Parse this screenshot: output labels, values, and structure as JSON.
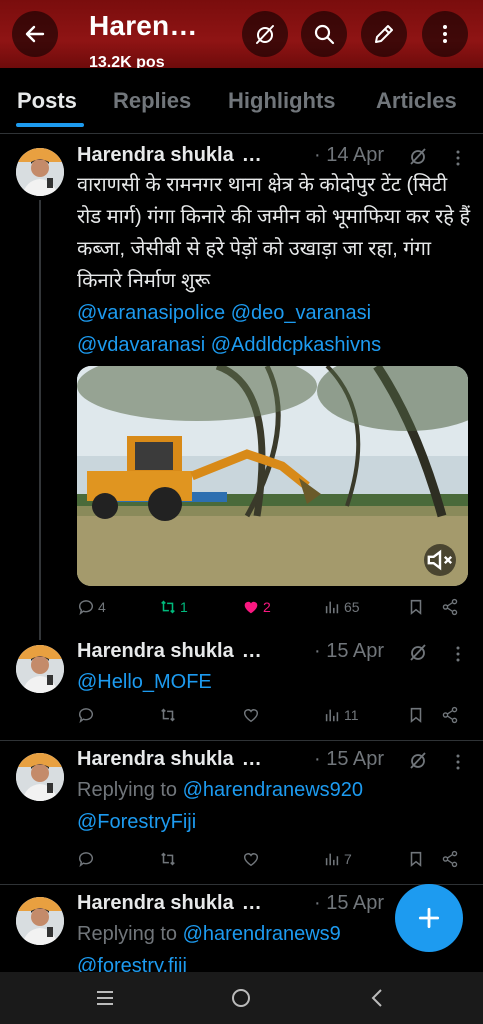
{
  "header": {
    "title": "Haren…",
    "subtitle": "13.2K pos",
    "back_icon": "arrow-left-icon",
    "muted_icon": "bell-off-icon",
    "search_icon": "search-icon",
    "compose_icon": "pen-icon",
    "more_icon": "more-vertical-icon"
  },
  "tabs": [
    {
      "label": "Posts",
      "active": true
    },
    {
      "label": "Replies",
      "active": false
    },
    {
      "label": "Highlights",
      "active": false
    },
    {
      "label": "Articles",
      "active": false
    }
  ],
  "posts": [
    {
      "author": "Harendra shukla",
      "ellipsis": "…",
      "date": "· 14 Apr",
      "text": "वाराणसी के रामनगर थाना क्षेत्र के कोदोपुर टेंट (सिटी रोड मार्ग) गंगा किनारे की जमीन को भूमाफिया कर रहे हैं कब्जा, जेसीबी से हरे पेड़ों को उखाड़ा जा रहा, गंगा किनारे निर्माण शुरू",
      "mentions_line1": "@varanasipolice @deo_varanasi",
      "mentions_line2": "@vdavaranasi @Addldcpkashivns",
      "replies": "4",
      "reposts": "1",
      "likes": "2",
      "views": "65"
    },
    {
      "author": "Harendra shukla",
      "ellipsis": "…",
      "date": "· 15 Apr",
      "mention": "@Hello_MOFE",
      "views": "11"
    },
    {
      "author": "Harendra shukla",
      "ellipsis": "…",
      "date": "· 15 Apr",
      "replying_prefix": "Replying to",
      "replying_to": "@harendranews920",
      "mention": "@ForestryFiji",
      "views": "7"
    },
    {
      "author": "Harendra shukla",
      "ellipsis": "…",
      "date": "· 15 Apr",
      "replying_prefix": "Replying to",
      "replying_to": "@harendranews9",
      "mention": "@forestry.fiji"
    }
  ],
  "colors": {
    "accent": "#1d9bf0",
    "repost": "#00ba7c",
    "like": "#f91880",
    "header_bg": "#8f1414"
  }
}
